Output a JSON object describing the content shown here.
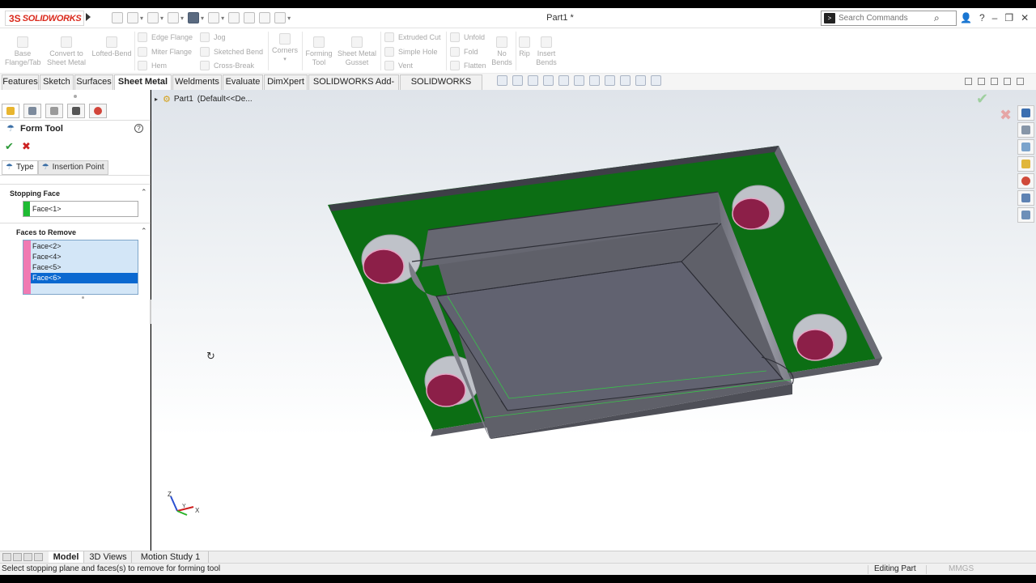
{
  "app": {
    "logo_ds": "3S",
    "logo_text": "SOLIDWORKS",
    "doc_title": "Part1 *",
    "search_placeholder": "Search Commands"
  },
  "commands": {
    "base_flange": "Base\nFlange/Tab",
    "convert": "Convert to\nSheet Metal",
    "lofted_bend": "Lofted-Bend",
    "edge_flange": "Edge Flange",
    "miter_flange": "Miter Flange",
    "hem": "Hem",
    "jog": "Jog",
    "sketched_bend": "Sketched Bend",
    "cross_break": "Cross-Break",
    "corners": "Corners",
    "forming_tool": "Forming\nTool",
    "gusset": "Sheet Metal\nGusset",
    "extruded_cut": "Extruded Cut",
    "simple_hole": "Simple Hole",
    "vent": "Vent",
    "unfold": "Unfold",
    "fold": "Fold",
    "flatten": "Flatten",
    "no_bends": "No\nBends",
    "rip": "Rip",
    "insert_bends": "Insert\nBends"
  },
  "tabs": [
    "Features",
    "Sketch",
    "Surfaces",
    "Sheet Metal",
    "Weldments",
    "Evaluate",
    "DimXpert",
    "SOLIDWORKS Add-Ins",
    "SOLIDWORKS MBD"
  ],
  "property_manager": {
    "title": "Form Tool",
    "help": "?",
    "subtab_type": "Type",
    "subtab_insertion": "Insertion Point",
    "stopping_face_label": "Stopping Face",
    "stopping_face_value": "Face<1>",
    "faces_to_remove_label": "Faces to Remove",
    "faces_to_remove": [
      "Face<2>",
      "Face<4>",
      "Face<5>",
      "Face<6>"
    ],
    "selected_face": "Face<6>",
    "colors": {
      "stopping_swatch": "#1fbb33",
      "remove_swatch": "#f07ab3",
      "selection": "#0a68d0"
    }
  },
  "viewport": {
    "tree_part": "Part1",
    "tree_config": "(Default<<De..."
  },
  "icons": {
    "terminal": ">",
    "magnifier": "⌕",
    "user": "👤",
    "help": "?",
    "minimize": "–",
    "restore": "❐",
    "close": "✕",
    "ok": "✔",
    "cancel": "✖",
    "accept": "✔",
    "reject": "✖",
    "rotate": "↻",
    "expand_caret": "▸",
    "part": "⚙",
    "collapse_caret": "⌃",
    "form_tool": "☂"
  },
  "bottom_tabs": [
    "Model",
    "3D Views",
    "Motion Study 1"
  ],
  "status": {
    "message": "Select stopping plane and faces(s) to remove for forming tool",
    "mode": "Editing Part",
    "units": "MMGS"
  }
}
